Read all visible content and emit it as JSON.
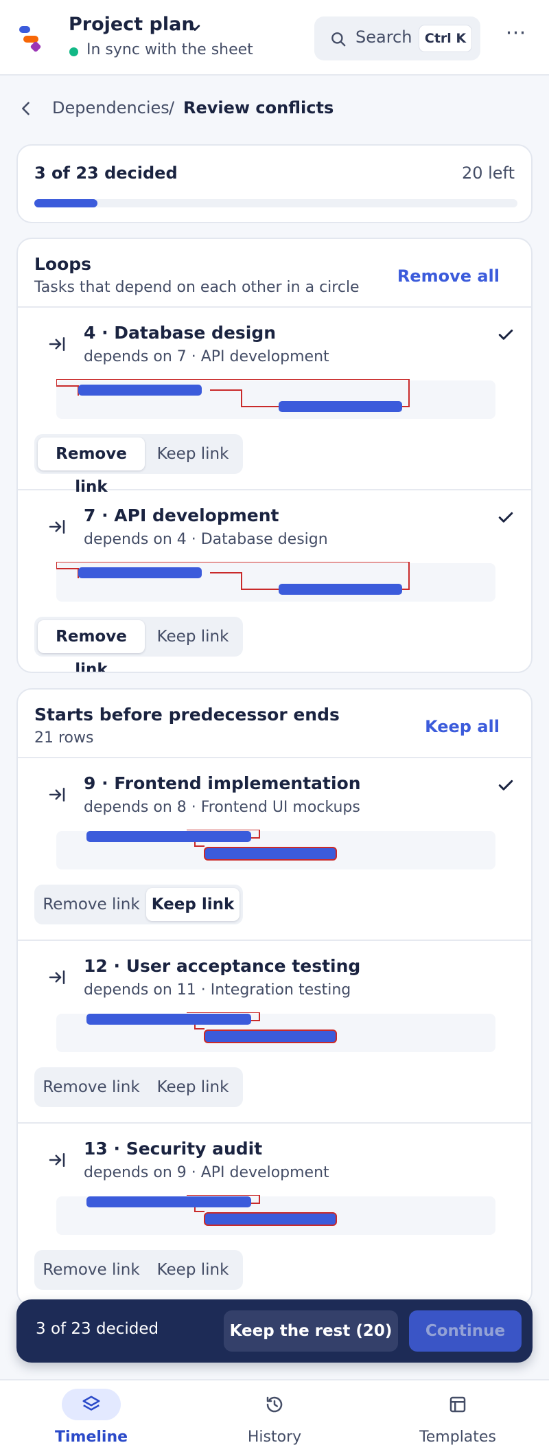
{
  "header": {
    "project_title": "Project plan",
    "sync_status": "In sync with the sheet",
    "search_label": "Search",
    "search_shortcut": "Ctrl K",
    "more_label": "⋯"
  },
  "breadcrumb": {
    "parent": "Dependencies",
    "separator": "/",
    "current": "Review conflicts"
  },
  "progress": {
    "summary": "3 of 23 decided",
    "remaining": "20 left",
    "decided": 3,
    "total": 23
  },
  "groups": [
    {
      "title": "Loops",
      "subtitle": "Tasks that depend on each other in a circle",
      "action_label": "Remove all",
      "rows": [
        {
          "title": "4 · Database design",
          "subtitle": "depends on 7 · API development",
          "remove_label": "Remove link",
          "keep_label": "Keep link",
          "selected": "remove",
          "decided": true
        },
        {
          "title": "7 · API development",
          "subtitle": "depends on 4 · Database design",
          "remove_label": "Remove link",
          "keep_label": "Keep link",
          "selected": "remove",
          "decided": true
        }
      ]
    },
    {
      "title": "Starts before predecessor ends",
      "subtitle": "21 rows",
      "action_label": "Keep all",
      "rows": [
        {
          "title": "9 · Frontend implementation",
          "subtitle": "depends on 8 · Frontend UI mockups",
          "remove_label": "Remove link",
          "keep_label": "Keep link",
          "selected": "keep",
          "decided": true
        },
        {
          "title": "12 · User acceptance testing",
          "subtitle": "depends on 11 · Integration testing",
          "remove_label": "Remove link",
          "keep_label": "Keep link",
          "selected": "none",
          "decided": false
        },
        {
          "title": "13 · Security audit",
          "subtitle": "depends on 9 · API development",
          "remove_label": "Remove link",
          "keep_label": "Keep link",
          "selected": "none",
          "decided": false
        }
      ]
    }
  ],
  "action_bar": {
    "summary": "3 of 23 decided",
    "keep_rest_label": "Keep the rest (20)",
    "continue_label": "Continue"
  },
  "bottom_nav": [
    {
      "label": "Timeline",
      "icon": "layers-icon",
      "active": true
    },
    {
      "label": "History",
      "icon": "history-icon",
      "active": false
    },
    {
      "label": "Templates",
      "icon": "templates-icon",
      "active": false
    }
  ],
  "colors": {
    "accent": "#3b5bdb",
    "conflict": "#c92a2a",
    "sync_ok": "#12b886",
    "action_bar": "#1d2b56"
  }
}
